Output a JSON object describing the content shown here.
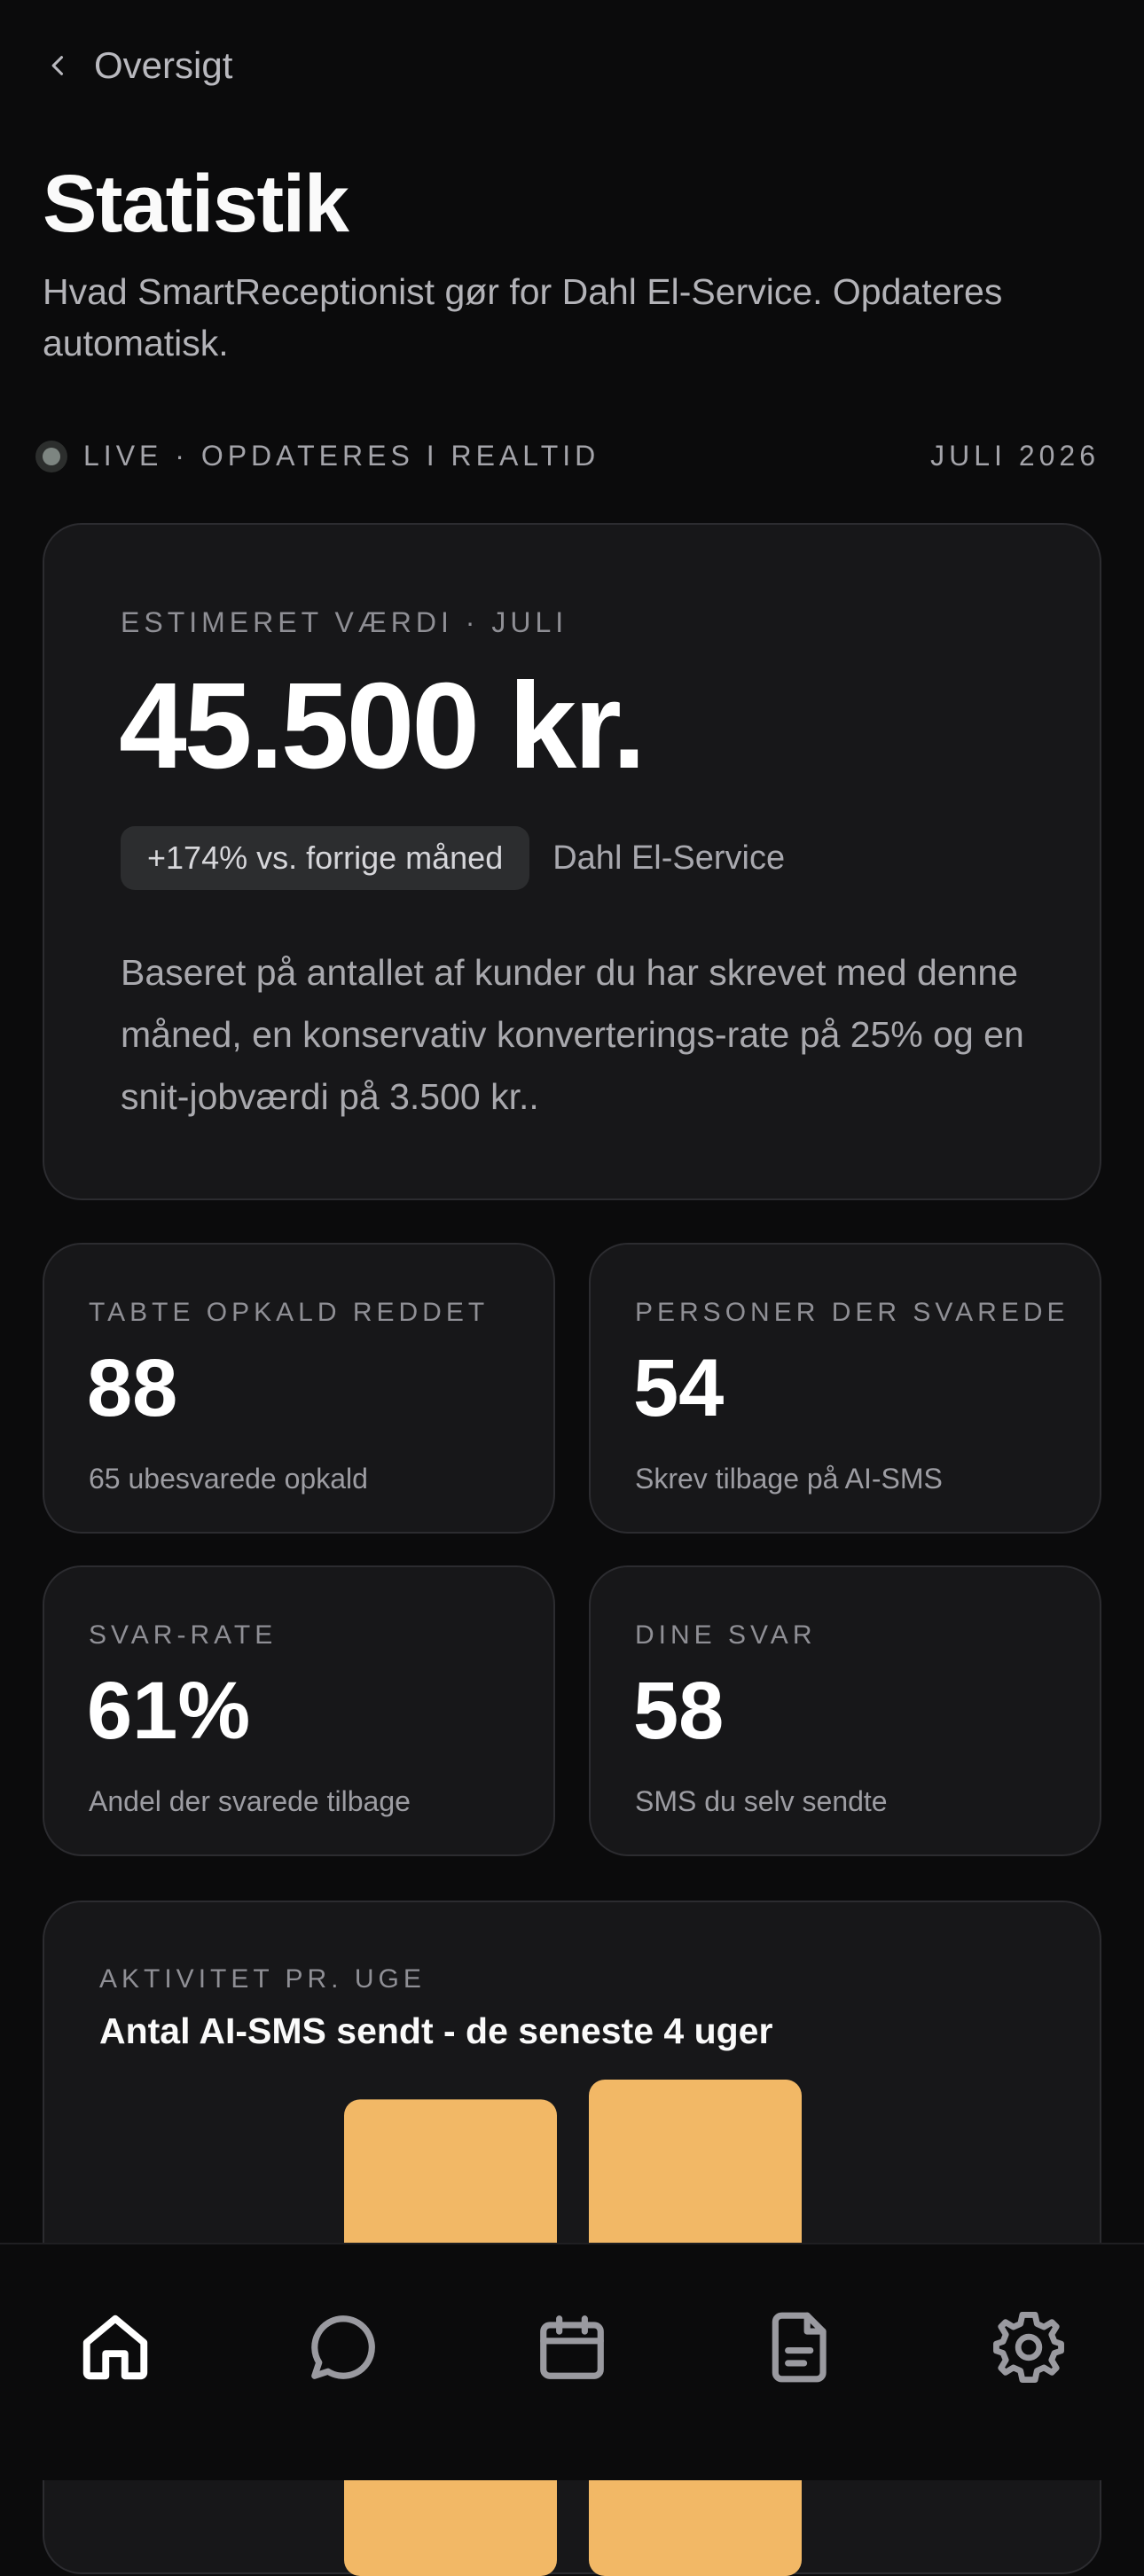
{
  "nav": {
    "back_label": "Oversigt"
  },
  "page": {
    "title": "Statistik",
    "subtitle": "Hvad SmartReceptionist gør for Dahl El-Service. Opdateres automatisk."
  },
  "status": {
    "live_label": "LIVE · OPDATERES I REALTID",
    "month": "JULI 2026"
  },
  "hero": {
    "eyebrow": "ESTIMERET VÆRDI · JULI",
    "value": "45.500 kr.",
    "change": "+174% vs. forrige måned",
    "company": "Dahl El-Service",
    "description": "Baseret på antallet af kunder du har skrevet med denne måned, en konservativ konverterings-rate på 25% og en snit-jobværdi på 3.500 kr.."
  },
  "stats": [
    {
      "label": "TABTE OPKALD REDDET",
      "value": "88",
      "sub": "65 ubesvarede opkald"
    },
    {
      "label": "PERSONER DER SVAREDE",
      "value": "54",
      "sub": "Skrev tilbage på AI-SMS"
    },
    {
      "label": "SVAR-RATE",
      "value": "61%",
      "sub": "Andel der svarede tilbage"
    },
    {
      "label": "DINE SVAR",
      "value": "58",
      "sub": "SMS du selv sendte"
    }
  ],
  "activity": {
    "eyebrow": "AKTIVITET PR. UGE",
    "title": "Antal AI-SMS sendt - de seneste 4 uger"
  },
  "chart_data": {
    "type": "bar",
    "title": "Antal AI-SMS sendt - de seneste 4 uger",
    "bar_color": "#f2b866",
    "visible_bars": 2,
    "note": "only the tops of two bars are visible; the chart is cut off by the bottom navigation",
    "relative_heights": [
      0.96,
      1.0
    ]
  },
  "tabbar": {
    "items": [
      {
        "name": "home",
        "icon": "home-icon",
        "active": true
      },
      {
        "name": "messages",
        "icon": "chat-bubble-icon",
        "active": false
      },
      {
        "name": "calendar",
        "icon": "calendar-icon",
        "active": false
      },
      {
        "name": "documents",
        "icon": "document-icon",
        "active": false
      },
      {
        "name": "settings",
        "icon": "gear-icon",
        "active": false
      }
    ]
  },
  "colors": {
    "background": "#0b0b0c",
    "card": "#171719",
    "accent_bar": "#f2b866",
    "icon_active": "#ffffff",
    "icon_inactive": "#9a9aa0"
  }
}
